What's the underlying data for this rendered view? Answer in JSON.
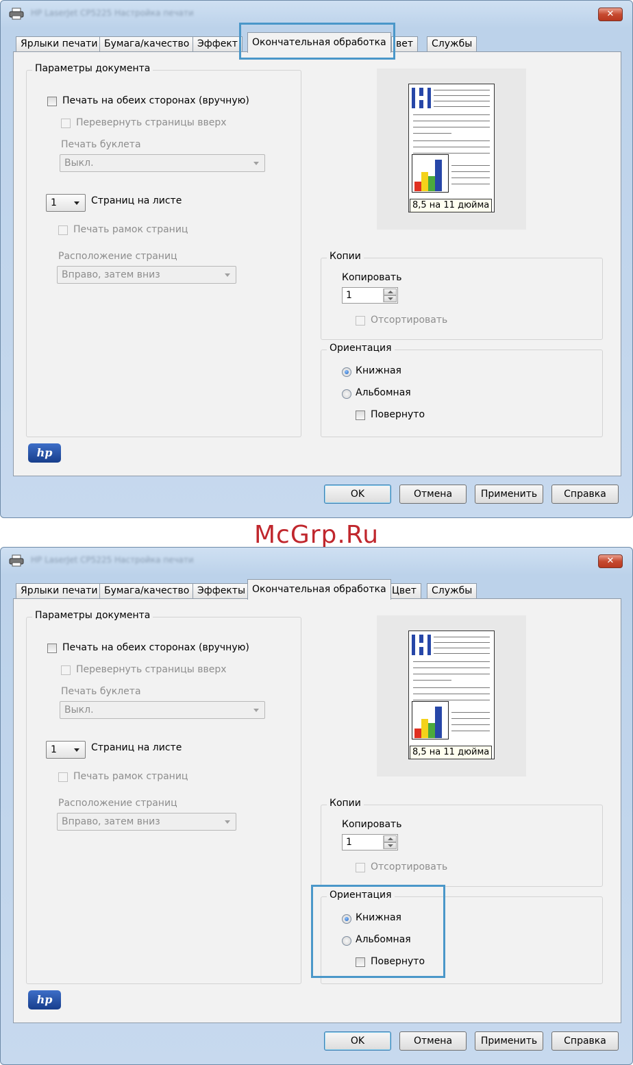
{
  "watermark": "McGrp.Ru",
  "colors": {
    "highlight": "#4a97c9",
    "watermark": "#c0272d",
    "close_button": "#c64a30"
  },
  "dialogs": [
    {
      "title": "HP LaserJet CP5225 Настройка печати",
      "tabs": [
        "Ярлыки печати",
        "Бумага/качество",
        "Эффект",
        "Окончательная обработка",
        "вет",
        "Службы"
      ],
      "doc_group": {
        "label": "Параметры документа",
        "duplex": "Печать на обеих сторонах (вручную)",
        "flip": "Перевернуть страницы вверх",
        "booklet_label": "Печать буклета",
        "booklet_value": "Выкл.",
        "pages_value": "1",
        "pages_label": "Страниц на листе",
        "borders": "Печать рамок страниц",
        "layout_label": "Расположение страниц",
        "layout_value": "Вправо, затем вниз"
      },
      "preview": {
        "paper": "8,5 на 11 дюйма"
      },
      "copies": {
        "label": "Копии",
        "copy_label": "Копировать",
        "value": "1",
        "collate": "Отсортировать"
      },
      "orientation": {
        "label": "Ориентация",
        "portrait": "Книжная",
        "landscape": "Альбомная",
        "rotated": "Повернуто",
        "selected": "portrait"
      },
      "buttons": {
        "ok": "OK",
        "cancel": "Отмена",
        "apply": "Применить",
        "help": "Справка"
      },
      "highlight": "finishing-tab"
    },
    {
      "title": "HP LaserJet CP5225 Настройка печати",
      "tabs": [
        "Ярлыки печати",
        "Бумага/качество",
        "Эффекты",
        "Окончательная обработка",
        "Цвет",
        "Службы"
      ],
      "doc_group": {
        "label": "Параметры документа",
        "duplex": "Печать на обеих сторонах (вручную)",
        "flip": "Перевернуть страницы вверх",
        "booklet_label": "Печать буклета",
        "booklet_value": "Выкл.",
        "pages_value": "1",
        "pages_label": "Страниц на листе",
        "borders": "Печать рамок страниц",
        "layout_label": "Расположение страниц",
        "layout_value": "Вправо, затем вниз"
      },
      "preview": {
        "paper": "8,5 на 11 дюйма"
      },
      "copies": {
        "label": "Копии",
        "copy_label": "Копировать",
        "value": "1",
        "collate": "Отсортировать"
      },
      "orientation": {
        "label": "Ориентация",
        "portrait": "Книжная",
        "landscape": "Альбомная",
        "rotated": "Повернуто",
        "selected": "portrait"
      },
      "buttons": {
        "ok": "OK",
        "cancel": "Отмена",
        "apply": "Применить",
        "help": "Справка"
      },
      "highlight": "orientation-group"
    }
  ]
}
